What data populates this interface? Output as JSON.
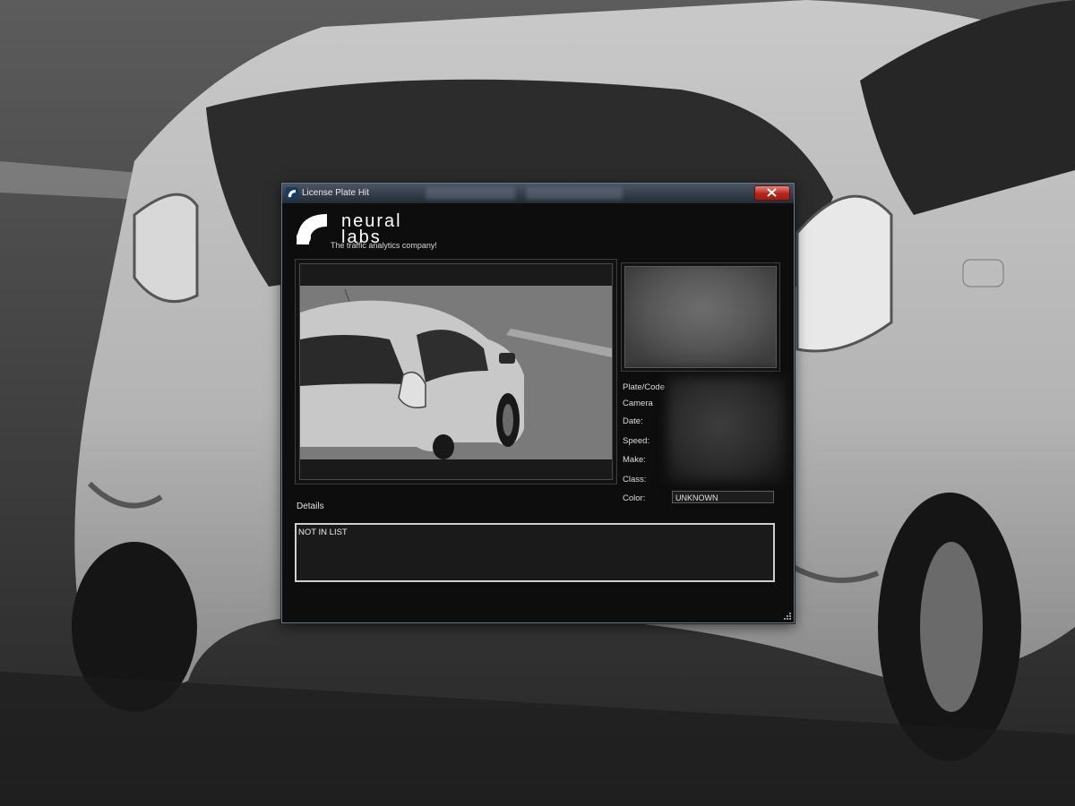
{
  "window": {
    "title": "License Plate Hit"
  },
  "logo": {
    "line1": "neural",
    "line2": "labs",
    "tagline": "The traffic analytics company!"
  },
  "fields": {
    "plate_label": "Plate/Code",
    "camera_label": "Camera",
    "date_label": "Date:",
    "speed_label": "Speed:",
    "make_label": "Make:",
    "class_label": "Class:",
    "color_label": "Color:",
    "color_value": "UNKNOWN"
  },
  "details": {
    "label": "Details",
    "text": "NOT IN LIST"
  },
  "icons": {
    "app": "neural-labs-logo-icon",
    "close": "close-icon",
    "resize": "resize-grip-icon"
  },
  "colors": {
    "close_button": "#c0392b",
    "window_bg": "#0d0d0d",
    "titlebar": "#3a4452"
  }
}
